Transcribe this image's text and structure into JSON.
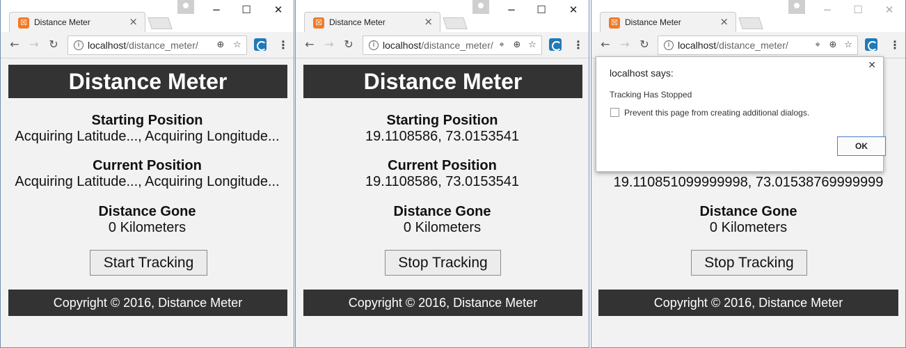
{
  "browser": {
    "tab_title": "Distance Meter",
    "tab_favicon": "xampp-favicon-icon",
    "url_host": "localhost",
    "url_path": "/distance_meter/",
    "url_path_truncated": "/distance_meter/"
  },
  "app": {
    "title": "Distance Meter",
    "starting_label": "Starting Position",
    "current_label": "Current Position",
    "distance_label": "Distance Gone",
    "footer": "Copyright © 2016, Distance Meter"
  },
  "windows": [
    {
      "starting_value": "Acquiring Latitude..., Acquiring Longitude...",
      "current_value": "Acquiring Latitude..., Acquiring Longitude...",
      "distance_value": "0 Kilometers",
      "button_label": "Start Tracking"
    },
    {
      "starting_value": "19.1108586, 73.0153541",
      "current_value": "19.1108586, 73.0153541",
      "distance_value": "0 Kilometers",
      "button_label": "Stop Tracking"
    },
    {
      "current_value": "19.110851099999998, 73.01538769999999",
      "distance_value": "0 Kilometers",
      "button_label": "Stop Tracking"
    }
  ],
  "dialog": {
    "title": "localhost says:",
    "message": "Tracking Has Stopped",
    "checkbox_label": "Prevent this page from creating additional dialogs.",
    "ok_label": "OK"
  }
}
